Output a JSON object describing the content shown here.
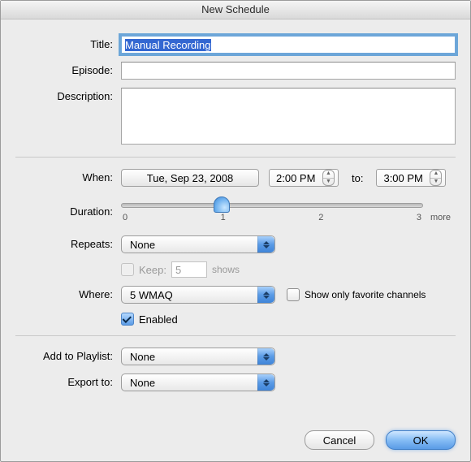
{
  "window": {
    "title": "New Schedule"
  },
  "form": {
    "title_label": "Title:",
    "title_value": "Manual Recording",
    "episode_label": "Episode:",
    "episode_value": "",
    "description_label": "Description:",
    "description_value": ""
  },
  "when": {
    "label": "When:",
    "date": "Tue, Sep 23, 2008",
    "start_time": "2:00 PM",
    "to_label": "to:",
    "end_time": "3:00 PM"
  },
  "duration": {
    "label": "Duration:",
    "ticks": [
      "0",
      "1",
      "2",
      "3"
    ],
    "more_label": "more",
    "value_fraction": 0.33
  },
  "repeats": {
    "label": "Repeats:",
    "value": "None",
    "keep_label": "Keep:",
    "keep_value": "5",
    "keep_unit": "shows",
    "keep_enabled": false
  },
  "where": {
    "label": "Where:",
    "value": "5 WMAQ",
    "fav_label": "Show only favorite channels",
    "fav_checked": false,
    "enabled_label": "Enabled",
    "enabled_checked": true
  },
  "playlist": {
    "label": "Add to Playlist:",
    "value": "None"
  },
  "export": {
    "label": "Export to:",
    "value": "None"
  },
  "buttons": {
    "cancel": "Cancel",
    "ok": "OK"
  }
}
